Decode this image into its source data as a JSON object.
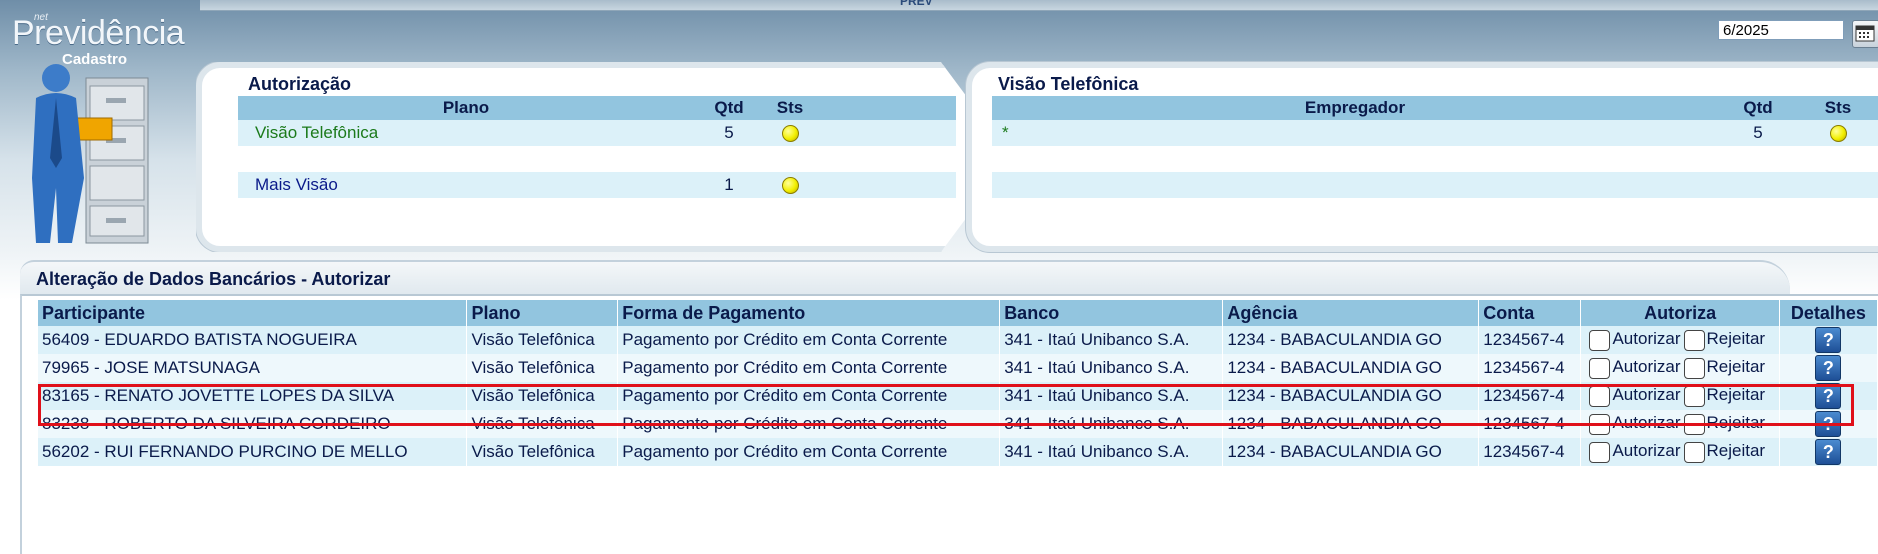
{
  "header": {
    "logo_net": "net",
    "logo_main": "Previdência",
    "logo_sub": "Cadastro",
    "top_label": "PREV",
    "date_value": "6/2025"
  },
  "autorizacao": {
    "title": "Autorização",
    "columns": [
      "Plano",
      "Qtd",
      "Sts"
    ],
    "rows": [
      {
        "plano": "Visão Telefônica",
        "qtd": "5",
        "plano_color": "#1b7a1b"
      },
      {
        "plano": "Mais Visão",
        "qtd": "1",
        "plano_color": "#0a1a8a"
      }
    ]
  },
  "visao_telefonica": {
    "title": "Visão Telefônica",
    "columns": [
      "Empregador",
      "Qtd",
      "Sts"
    ],
    "rows": [
      {
        "empregador": "*",
        "qtd": "5"
      }
    ]
  },
  "bank_changes": {
    "title": "Alteração de Dados Bancários - Autorizar",
    "columns": [
      "Participante",
      "Plano",
      "Forma de Pagamento",
      "Banco",
      "Agência",
      "Conta",
      "Autoriza",
      "Detalhes"
    ],
    "authorize_label": "Autorizar",
    "reject_label": "Rejeitar",
    "rows": [
      {
        "participante": "56409 - EDUARDO BATISTA NOGUEIRA",
        "plano": "Visão Telefônica",
        "forma": "Pagamento por Crédito em Conta Corrente",
        "banco": "341 - Itaú Unibanco S.A.",
        "agencia": "1234 - BABACULANDIA GO",
        "conta": "1234567-4"
      },
      {
        "participante": "79965 - JOSE MATSUNAGA",
        "plano": "Visão Telefônica",
        "forma": "Pagamento por Crédito em Conta Corrente",
        "banco": "341 - Itaú Unibanco S.A.",
        "agencia": "1234 - BABACULANDIA GO",
        "conta": "1234567-4"
      },
      {
        "participante": "83165 - RENATO JOVETTE LOPES DA SILVA",
        "plano": "Visão Telefônica",
        "forma": "Pagamento por Crédito em Conta Corrente",
        "banco": "341 - Itaú Unibanco S.A.",
        "agencia": "1234 - BABACULANDIA GO",
        "conta": "1234567-4"
      },
      {
        "participante": "83238 - ROBERTO DA SILVEIRA CORDEIRO",
        "plano": "Visão Telefônica",
        "forma": "Pagamento por Crédito em Conta Corrente",
        "banco": "341 - Itaú Unibanco S.A.",
        "agencia": "1234 - BABACULANDIA GO",
        "conta": "1234567-4"
      },
      {
        "participante": "56202 - RUI FERNANDO PURCINO DE MELLO",
        "plano": "Visão Telefônica",
        "forma": "Pagamento por Crédito em Conta Corrente",
        "banco": "341 - Itaú Unibanco S.A.",
        "agencia": "1234 - BABACULANDIA GO",
        "conta": "1234567-4"
      }
    ],
    "highlighted_row": 2
  },
  "colors": {
    "header_blue": "#92c5df",
    "row_light": "#dcf1f9",
    "highlight_red": "#e0101a",
    "status_yellow": "#f2ef00"
  },
  "icons": {
    "status": "yellow-status-dot",
    "details": "help-icon",
    "calendar": "calendar-icon"
  }
}
